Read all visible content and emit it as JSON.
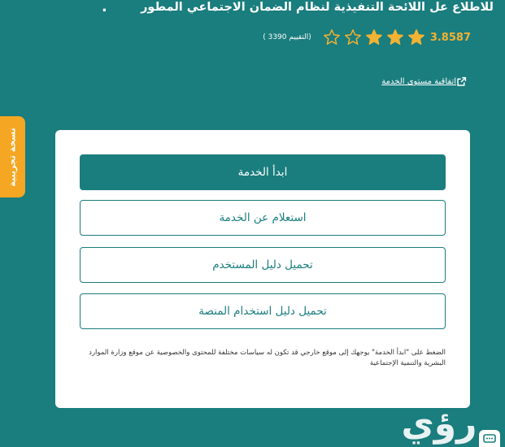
{
  "page": {
    "title": "للاطلاع عل اللائحة التنفيذية لنظام الضمان الاجتماعي المطور",
    "dot": "."
  },
  "rating": {
    "value": "3.8587",
    "stars_filled": 3,
    "stars_total": 5,
    "count_text": "(التقييم 3390 )",
    "star_color": "#f2b233"
  },
  "links": {
    "sla": "اتفاقية مستوى الخدمة"
  },
  "beta_tab": {
    "label": "نسخة تجريبية",
    "color": "#f5a623"
  },
  "actions": {
    "start": "ابدأ الخدمة",
    "inquiry": "استعلام عن الخدمة",
    "user_guide": "تحميل دليل المستخدم",
    "platform_guide": "تحميل دليل استخدام المنصة"
  },
  "disclaimer": "الضغط على \"ابدأ الخدمة\" يوجهك إلى موقع خارجي قد تكون له سياسات مختلفة للمحتوى والخصوصية عن موقع وزارة الموارد البشرية والتنمية الإجتماعية",
  "watermark": {
    "text": "رؤي"
  },
  "theme": {
    "primary": "#1a7d7e",
    "card": "#ffffff"
  }
}
